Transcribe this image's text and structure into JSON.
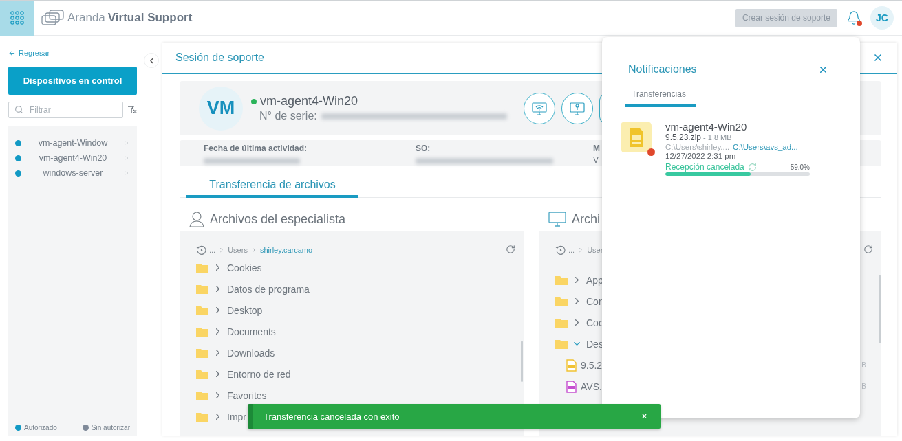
{
  "header": {
    "brand_light": "Aranda",
    "brand_bold": "Virtual Support",
    "create_button": {
      "label": "Crear sesión de soporte",
      "disabled": true
    },
    "notifications_unread": true,
    "avatar": "JC"
  },
  "sidebar": {
    "back_link": "Regresar",
    "title_button": "Dispositivos en control",
    "filter": {
      "placeholder": "Filtrar"
    },
    "devices": [
      {
        "name": "vm-agent-Window",
        "color": "#1199c4"
      },
      {
        "name": "vm-agent4-Win20",
        "color": "#1199c4"
      },
      {
        "name": "windows-server",
        "color": "#1199c4"
      }
    ],
    "legend": [
      {
        "label": "Autorizado",
        "color": "#1199c4"
      },
      {
        "label": "Sin autorizar",
        "color": "#7f8a99"
      }
    ]
  },
  "session": {
    "title": "Sesión de soporte",
    "device": {
      "initials": "VM",
      "name": "vm-agent4-Win20",
      "online": true,
      "serial_label": "N° de serie:"
    },
    "info": [
      {
        "label": "Fecha de última actividad:"
      },
      {
        "label": "SO:"
      },
      {
        "label": "M",
        "value": "V"
      }
    ],
    "tabs": [
      {
        "label": "Transferencia de archivos",
        "selected": true
      }
    ],
    "panes": [
      {
        "kind": "specialist",
        "title": "Archivos del especialista",
        "breadcrumb": [
          "...",
          "Users",
          "shirley.carcamo"
        ],
        "items": [
          {
            "kind": "folder",
            "name": "Cookies",
            "expanded": false
          },
          {
            "kind": "folder",
            "name": "Datos de programa",
            "expanded": false
          },
          {
            "kind": "folder",
            "name": "Desktop",
            "expanded": false
          },
          {
            "kind": "folder",
            "name": "Documents",
            "expanded": false
          },
          {
            "kind": "folder",
            "name": "Downloads",
            "expanded": false
          },
          {
            "kind": "folder",
            "name": "Entorno de red",
            "expanded": false
          },
          {
            "kind": "folder",
            "name": "Favorites",
            "expanded": false
          },
          {
            "kind": "folder",
            "name": "Impr",
            "expanded": false
          }
        ]
      },
      {
        "kind": "device",
        "title": "Archi",
        "breadcrumb": [
          "...",
          "User"
        ],
        "items": [
          {
            "kind": "folder",
            "name": "App",
            "expanded": false
          },
          {
            "kind": "folder",
            "name": "Con",
            "expanded": false
          },
          {
            "kind": "folder",
            "name": "Coo",
            "expanded": false
          },
          {
            "kind": "folder",
            "name": "Des",
            "expanded": true,
            "children": [
              {
                "kind": "zip",
                "name": "9.5.2",
                "size": "B"
              },
              {
                "kind": "exe",
                "name": "AVS.",
                "size": "B"
              }
            ]
          }
        ]
      }
    ]
  },
  "notifications": {
    "title": "Notificaciones",
    "tabs": [
      {
        "label": "Transferencias",
        "selected": true
      }
    ],
    "items": [
      {
        "device": "vm-agent4-Win20",
        "file": "9.5.23.zip",
        "size": "- 1,8 MB",
        "source": "C:\\Users\\shirley....",
        "destination": "C:\\Users\\avs_ad...",
        "date": "12/27/2022 2:31 pm",
        "status": "Recepción cancelada",
        "color": "#e0482c",
        "percent": "59.0%",
        "level": 0.59
      }
    ]
  },
  "toast": {
    "message": "Transferencia cancelada con éxito",
    "close": "×"
  }
}
